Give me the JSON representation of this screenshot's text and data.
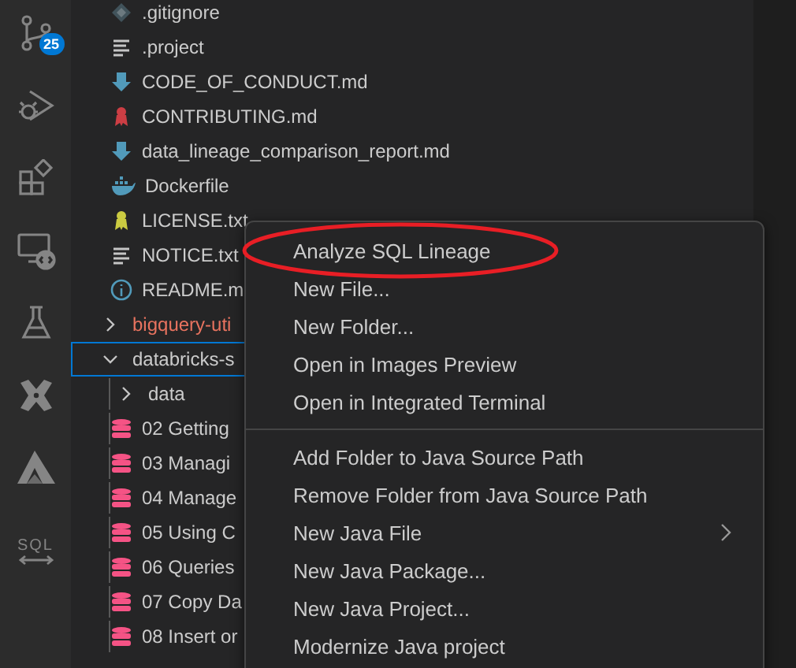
{
  "activity_bar": {
    "items": [
      {
        "kind": "source-control",
        "badge": "25"
      },
      {
        "kind": "run-debug"
      },
      {
        "kind": "extensions"
      },
      {
        "kind": "remote"
      },
      {
        "kind": "testing"
      },
      {
        "kind": "cross"
      },
      {
        "kind": "a-logo"
      },
      {
        "kind": "sql",
        "label": "SQL"
      }
    ]
  },
  "explorer": {
    "items": [
      {
        "kind": "git",
        "name": ".gitignore",
        "focused": false
      },
      {
        "kind": "text",
        "name": ".project",
        "focused": false
      },
      {
        "kind": "markdown",
        "name": "CODE_OF_CONDUCT.md",
        "focused": false
      },
      {
        "kind": "contributing",
        "name": "CONTRIBUTING.md",
        "focused": false
      },
      {
        "kind": "markdown",
        "name": "data_lineage_comparison_report.md",
        "focused": false
      },
      {
        "kind": "docker",
        "name": "Dockerfile",
        "focused": false
      },
      {
        "kind": "license",
        "name": "LICENSE.txt",
        "focused": false
      },
      {
        "kind": "text",
        "name": "NOTICE.txt",
        "focused": false
      },
      {
        "kind": "info",
        "name": "README.m",
        "focused": false
      },
      {
        "kind": "folder",
        "name": "bigquery-uti",
        "color": "#e8735f",
        "expanded": false,
        "focused": false
      },
      {
        "kind": "folder",
        "name": "databricks-s",
        "expanded": true,
        "focused": true,
        "children": [
          {
            "kind": "folder",
            "name": "data",
            "expanded": false,
            "focused": false
          },
          {
            "kind": "database",
            "name": "02 Getting",
            "focused": false
          },
          {
            "kind": "database",
            "name": "03 Managi",
            "focused": false
          },
          {
            "kind": "database",
            "name": "04 Manage",
            "focused": false
          },
          {
            "kind": "database",
            "name": "05 Using C",
            "focused": false
          },
          {
            "kind": "database",
            "name": "06 Queries",
            "focused": false
          },
          {
            "kind": "database",
            "name": "07 Copy Da",
            "focused": false
          },
          {
            "kind": "database",
            "name": "08 Insert or",
            "focused": false
          }
        ]
      }
    ]
  },
  "context_menu": {
    "items": [
      {
        "kind": "item",
        "label": "Analyze SQL Lineage",
        "submenu": false,
        "circled": true
      },
      {
        "kind": "item",
        "label": "New File...",
        "submenu": false,
        "circled": false
      },
      {
        "kind": "item",
        "label": "New Folder...",
        "submenu": false,
        "circled": false
      },
      {
        "kind": "item",
        "label": "Open in Images Preview",
        "submenu": false,
        "circled": false
      },
      {
        "kind": "item",
        "label": "Open in Integrated Terminal",
        "submenu": false,
        "circled": false
      },
      {
        "kind": "separator"
      },
      {
        "kind": "item",
        "label": "Add Folder to Java Source Path",
        "submenu": false,
        "circled": false
      },
      {
        "kind": "item",
        "label": "Remove Folder from Java Source Path",
        "submenu": false,
        "circled": false
      },
      {
        "kind": "item",
        "label": "New Java File",
        "submenu": true,
        "circled": false
      },
      {
        "kind": "item",
        "label": "New Java Package...",
        "submenu": false,
        "circled": false
      },
      {
        "kind": "item",
        "label": "New Java Project...",
        "submenu": false,
        "circled": false
      },
      {
        "kind": "item",
        "label": "Modernize Java project",
        "submenu": false,
        "circled": false
      }
    ]
  }
}
